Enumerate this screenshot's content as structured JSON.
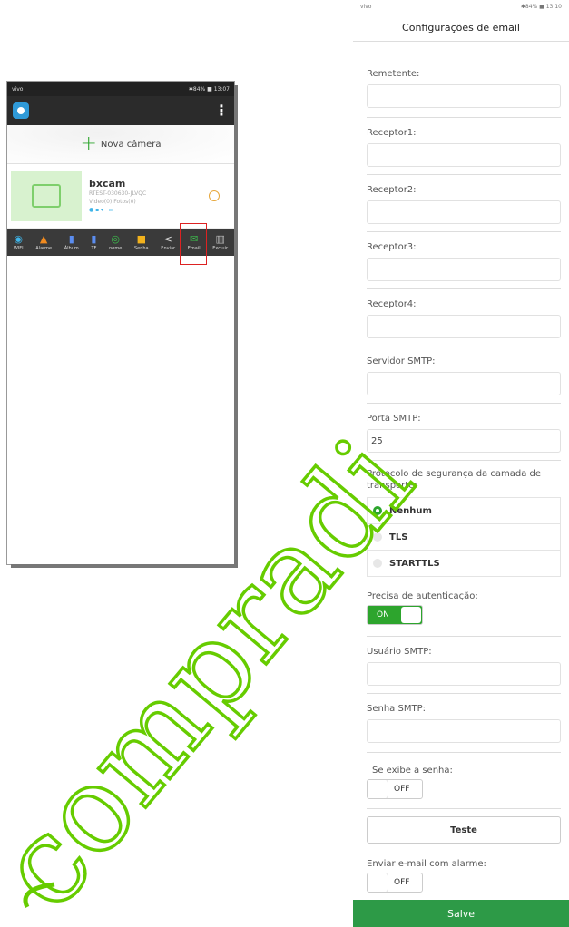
{
  "left_phone": {
    "status_bar": {
      "left": "vivo",
      "right": "✱84% ■ 13:07"
    },
    "add_camera_label": "Nova câmera",
    "camera": {
      "name": "bxcam",
      "uid": "RTEST-030630-JLVQC",
      "counts": "Video(0) Fotos(0)"
    },
    "toolbar": [
      {
        "icon": "wifi-icon",
        "label": "WIFI",
        "color": "#3fb4e8"
      },
      {
        "icon": "bell-icon",
        "label": "Alarme",
        "color": "#f08a1f"
      },
      {
        "icon": "album-icon",
        "label": "Álbum",
        "color": "#5b8df0"
      },
      {
        "icon": "sd-card-icon",
        "label": "TF",
        "color": "#5b8df0"
      },
      {
        "icon": "name-icon",
        "label": "nome",
        "color": "#3cbf4c"
      },
      {
        "icon": "lock-icon",
        "label": "Senha",
        "color": "#f2b21d"
      },
      {
        "icon": "share-icon",
        "label": "Enviar",
        "color": "#dddddd"
      },
      {
        "icon": "email-icon",
        "label": "Email",
        "color": "#3cbf4c"
      },
      {
        "icon": "trash-icon",
        "label": "Excluir",
        "color": "#bbbbbb"
      }
    ]
  },
  "right_phone": {
    "status_bar": {
      "left": "vivo",
      "right": "✱84% ■ 13:10"
    },
    "title": "Configurações de email",
    "fields": {
      "remetente": "Remetente:",
      "receptor1": "Receptor1:",
      "receptor2": "Receptor2:",
      "receptor3": "Receptor3:",
      "receptor4": "Receptor4:",
      "servidor": "Servidor SMTP:",
      "porta": "Porta SMTP:",
      "porta_value": "25",
      "usuario": "Usuário SMTP:",
      "senha": "Senha SMTP:"
    },
    "protocol": {
      "label": "Protocolo de segurança da camada de transporte:",
      "options": [
        "Nenhum",
        "TLS",
        "STARTTLS"
      ],
      "selected": "Nenhum"
    },
    "auth": {
      "label": "Precisa de autenticação:",
      "state": "ON"
    },
    "show_password": {
      "label": "Se exibe a senha:",
      "state": "OFF"
    },
    "test_button": "Teste",
    "alarm_email": {
      "label": "Enviar e-mail com alarme:",
      "state": "OFF"
    },
    "save_button": "Salve"
  },
  "watermark": "compradi",
  "colors": {
    "accent_green": "#2da52d",
    "save_green": "#2d9a47",
    "watermark_green": "#66cc00",
    "highlight_red": "#dd2222"
  }
}
